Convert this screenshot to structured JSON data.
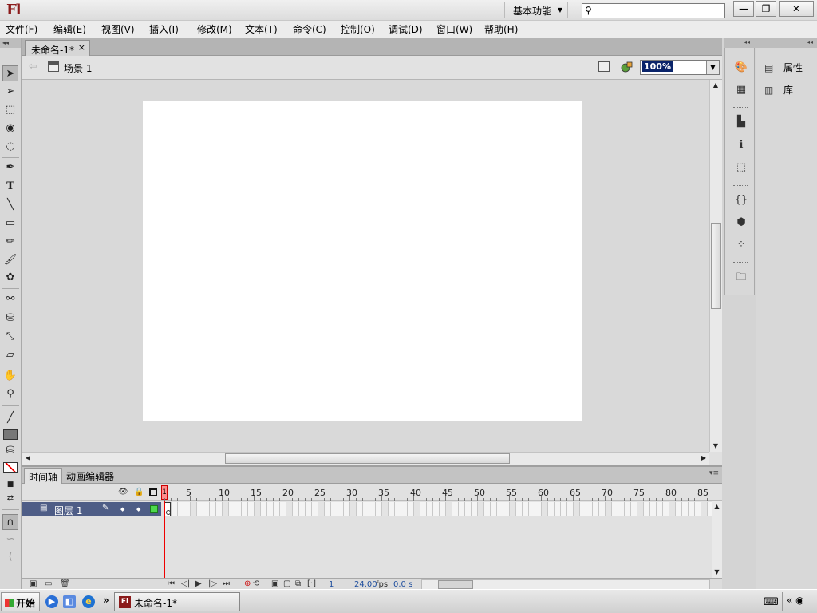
{
  "app": {
    "logo": "Fl",
    "workspace": "基本功能",
    "search_placeholder": ""
  },
  "window_buttons": {
    "minimize": "—",
    "restore": "❐",
    "close": "✕"
  },
  "menu": [
    "文件(F)",
    "编辑(E)",
    "视图(V)",
    "插入(I)",
    "修改(M)",
    "文本(T)",
    "命令(C)",
    "控制(O)",
    "调试(D)",
    "窗口(W)",
    "帮助(H)"
  ],
  "document": {
    "tab_title": "未命名-1*",
    "scene": "场景 1",
    "zoom": "100%"
  },
  "timeline": {
    "tabs": [
      "时间轴",
      "动画编辑器"
    ],
    "ruler": [
      "1",
      "5",
      "10",
      "15",
      "20",
      "25",
      "30",
      "35",
      "40",
      "45",
      "50",
      "55",
      "60",
      "65",
      "70",
      "75",
      "80",
      "85"
    ],
    "layer_name": "图层 1",
    "layer_color": "#4dd84d",
    "current_frame": "1",
    "fps": "24.00",
    "fps_unit": "fps",
    "time": "0.0 s"
  },
  "panels": {
    "properties": "属性",
    "library": "库"
  },
  "taskbar": {
    "start": "开始",
    "task_title": "未命名-1*",
    "more": "»",
    "tray_arrows": "«"
  },
  "colors": {
    "stage_bg": "#ffffff",
    "workspace_bg": "#d9d9d9",
    "layer_selected": "#4e5d86",
    "playhead": "#ee0000"
  }
}
